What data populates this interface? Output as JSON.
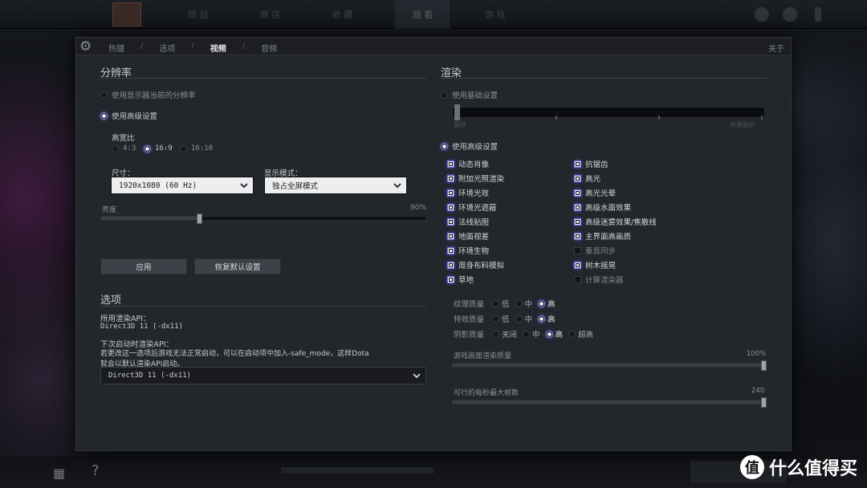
{
  "window_tabs_bg": [
    "观 战",
    "商 店",
    "收 藏",
    "观 看",
    "游 戏"
  ],
  "settings_tabs": [
    "热键",
    "选项",
    "视频",
    "音频"
  ],
  "active_tab": "视频",
  "about_label": "关于",
  "resolution": {
    "title": "分辨率",
    "use_monitor": "使用显示器当前的分辨率",
    "use_advanced": "使用高级设置",
    "aspect_label": "高宽比",
    "aspect_options": [
      "4:3",
      "16:9",
      "16:10"
    ],
    "aspect_selected": "16:9",
    "size_label": "尺寸：",
    "size_value": "1920x1080 (60 Hz)",
    "display_mode_label": "显示模式：",
    "display_mode_value": "独占全屏模式",
    "brightness_label": "亮度",
    "brightness_value": "90%",
    "brightness_level": 0.3,
    "apply_button": "应用",
    "restore_button": "恢复默认设置"
  },
  "options": {
    "title": "选项",
    "current_api_label": "所用渲染API：",
    "current_api_value": "Direct3D 11 (-dx11)",
    "next_api_label": "下次启动时渲染API：",
    "next_api_hint_1": "若更改这一选项后游戏无法正常启动，可以在启动项中加入-safe_mode，这样Dota",
    "next_api_hint_2": "就会以默认渲染API启动。",
    "api_select_value": "Direct3D 11 (-dx11)"
  },
  "render": {
    "title": "渲染",
    "use_basic": "使用基础设置",
    "basic_left": "最快",
    "basic_right": "效果最好",
    "use_advanced": "使用高级设置",
    "left_checks": [
      {
        "label": "动态肖像",
        "checked": true
      },
      {
        "label": "附加光照渲染",
        "checked": true
      },
      {
        "label": "环境光效",
        "checked": true
      },
      {
        "label": "环境光遮蔽",
        "checked": true
      },
      {
        "label": "法线贴图",
        "checked": true
      },
      {
        "label": "地面视差",
        "checked": true
      },
      {
        "label": "环境生物",
        "checked": true
      },
      {
        "label": "周身布料模拟",
        "checked": true
      },
      {
        "label": "草地",
        "checked": true
      }
    ],
    "right_checks": [
      {
        "label": "抗锯齿",
        "checked": true
      },
      {
        "label": "高光",
        "checked": true
      },
      {
        "label": "高光光晕",
        "checked": true
      },
      {
        "label": "高级水面效果",
        "checked": true
      },
      {
        "label": "高级迷雾效果/焦散线",
        "checked": true
      },
      {
        "label": "主界面高画质",
        "checked": true
      },
      {
        "label": "垂直同步",
        "checked": false
      },
      {
        "label": "树木摇晃",
        "checked": true
      },
      {
        "label": "计算渲染器",
        "checked": false
      }
    ],
    "texture_quality_label": "纹理质量",
    "texture_options": [
      "低",
      "中",
      "高"
    ],
    "texture_selected": "高",
    "effects_quality_label": "特效质量",
    "effects_options": [
      "低",
      "中",
      "高"
    ],
    "effects_selected": "高",
    "shadow_quality_label": "阴影质量",
    "shadow_options": [
      "关闭",
      "中",
      "高",
      "超高"
    ],
    "shadow_selected": "高",
    "render_quality_label": "游戏画面渲染质量",
    "render_quality_value": "100%",
    "render_quality_level": 1.0,
    "max_fps_label": "可行的每秒最大帧数",
    "max_fps_value": "240",
    "max_fps_level": 1.0
  },
  "watermark": {
    "badge": "值",
    "text": "什么值得买"
  },
  "colors": {
    "accent": "#8a8eea",
    "panel_bg": "#23262a"
  }
}
